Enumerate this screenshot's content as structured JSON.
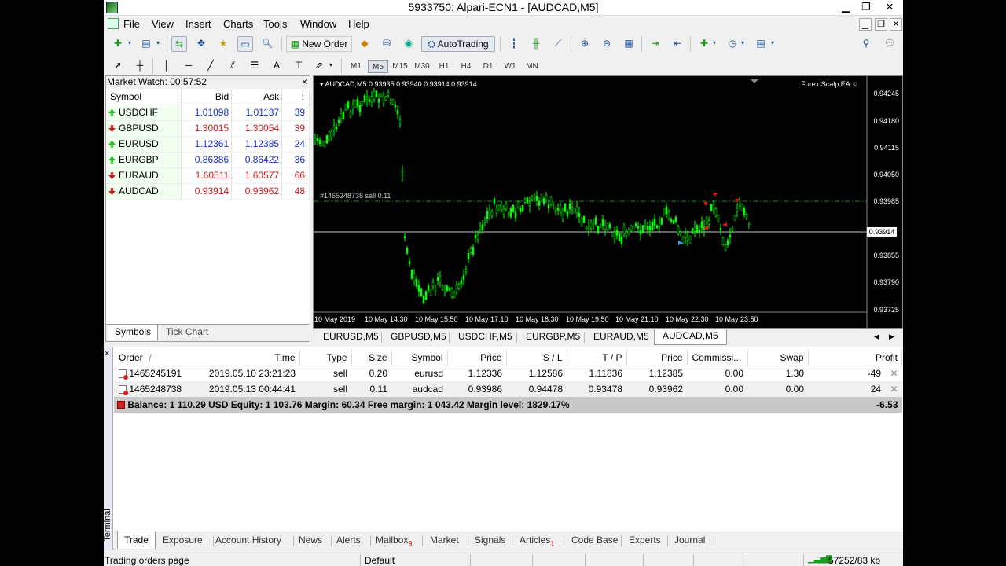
{
  "window": {
    "title": "5933750: Alpari-ECN1 - [AUDCAD,M5]"
  },
  "menu": [
    "File",
    "View",
    "Insert",
    "Charts",
    "Tools",
    "Window",
    "Help"
  ],
  "toolbar": {
    "new_order": "New Order",
    "autotrading": "AutoTrading"
  },
  "timeframes": [
    "M1",
    "M5",
    "M15",
    "M30",
    "H1",
    "H4",
    "D1",
    "W1",
    "MN"
  ],
  "active_timeframe": "M5",
  "market_watch": {
    "title": "Market Watch: 00:57:52",
    "close": "×",
    "headers": [
      "Symbol",
      "Bid",
      "Ask",
      "!"
    ],
    "rows": [
      {
        "symbol": "USDCHF",
        "bid": "1.01098",
        "ask": "1.01137",
        "spread": "39",
        "dir": "up",
        "color": "blue"
      },
      {
        "symbol": "GBPUSD",
        "bid": "1.30015",
        "ask": "1.30054",
        "spread": "39",
        "dir": "down",
        "color": "red"
      },
      {
        "symbol": "EURUSD",
        "bid": "1.12361",
        "ask": "1.12385",
        "spread": "24",
        "dir": "up",
        "color": "blue"
      },
      {
        "symbol": "EURGBP",
        "bid": "0.86386",
        "ask": "0.86422",
        "spread": "36",
        "dir": "up",
        "color": "blue"
      },
      {
        "symbol": "EURAUD",
        "bid": "1.60511",
        "ask": "1.60577",
        "spread": "66",
        "dir": "down",
        "color": "red"
      },
      {
        "symbol": "AUDCAD",
        "bid": "0.93914",
        "ask": "0.93962",
        "spread": "48",
        "dir": "down",
        "color": "red"
      }
    ],
    "tabs": [
      "Symbols",
      "Tick Chart"
    ]
  },
  "chart": {
    "header": "AUDCAD,M5  0.93935 0.93940 0.93914 0.93914",
    "ea": "Forex Scalp EA ☺",
    "order_label": "#1465248738 sell 0.11",
    "current_price": "0.93914",
    "y_ticks": [
      "0.94245",
      "0.94180",
      "0.94115",
      "0.94050",
      "0.93985",
      "0.93855",
      "0.93790",
      "0.93725"
    ],
    "x_ticks": [
      "10 May 2019",
      "10 May 14:30",
      "10 May 15:50",
      "10 May 17:10",
      "10 May 18:30",
      "10 May 19:50",
      "10 May 21:10",
      "10 May 22:30",
      "10 May 23:50"
    ],
    "colors": {
      "bull": "#00ff00",
      "order_line": "#1e8a1e",
      "bid_line": "#c0c0c0"
    }
  },
  "chart_tabs": [
    "EURUSD,M5",
    "GBPUSD,M5",
    "USDCHF,M5",
    "EURGBP,M5",
    "EURAUD,M5",
    "AUDCAD,M5"
  ],
  "active_chart_tab": "AUDCAD,M5",
  "terminal": {
    "side_label": "Terminal",
    "close": "×",
    "headers": [
      "Order",
      "/",
      "Time",
      "Type",
      "Size",
      "Symbol",
      "Price",
      "S / L",
      "T / P",
      "Price",
      "Commissi...",
      "Swap",
      "Profit"
    ],
    "rows": [
      {
        "order": "1465245191",
        "time": "2019.05.10 23:21:23",
        "type": "sell",
        "size": "0.20",
        "symbol": "eurusd",
        "price": "1.12336",
        "sl": "1.12586",
        "tp": "1.11836",
        "cur": "1.12385",
        "comm": "0.00",
        "swap": "1.30",
        "profit": "-49"
      },
      {
        "order": "1465248738",
        "time": "2019.05.13 00:44:41",
        "type": "sell",
        "size": "0.11",
        "symbol": "audcad",
        "price": "0.93986",
        "sl": "0.94478",
        "tp": "0.93478",
        "cur": "0.93962",
        "comm": "0.00",
        "swap": "0.00",
        "profit": "24"
      }
    ],
    "balance_line": "Balance: 1 110.29 USD  Equity: 1 103.76  Margin: 60.34  Free margin: 1 043.42  Margin level: 1829.17%",
    "total_profit": "-6.53",
    "tabs": [
      "Trade",
      "Exposure",
      "Account History",
      "News",
      "Alerts",
      "Mailbox",
      "Market",
      "Signals",
      "Articles",
      "Code Base",
      "Experts",
      "Journal"
    ],
    "mailbox_badge": "9",
    "articles_badge": "1"
  },
  "status": {
    "left": "Trading orders page",
    "profile": "Default",
    "traffic": "57252/83 kb"
  }
}
